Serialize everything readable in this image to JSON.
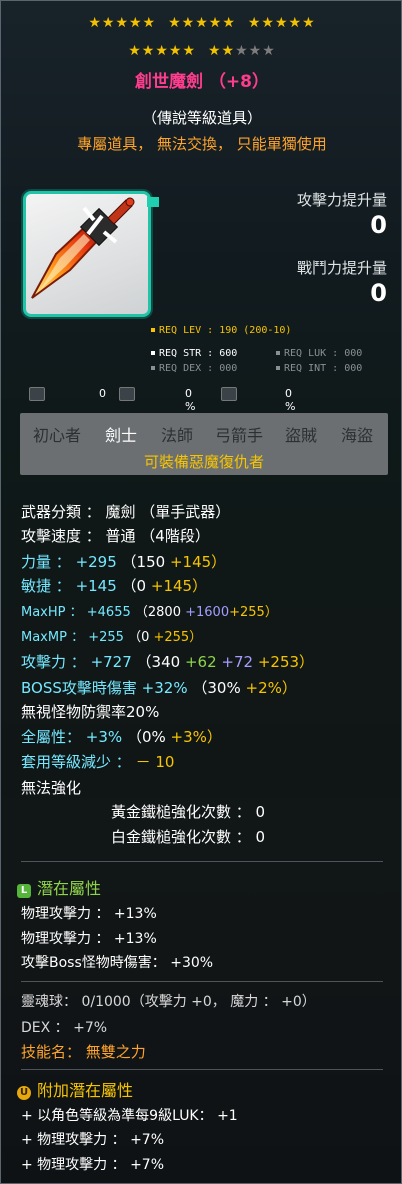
{
  "stars": {
    "row1": "★★★★★",
    "row2": "★★★★★",
    "row3": "★★★★★",
    "row4_on": "★★★★★",
    "row5_on": "★★",
    "row5_off": "★★★"
  },
  "item": {
    "name": "創世魔劍 （+8）",
    "grade": "（傳說等級道具）",
    "trade": "專屬道具， 無法交換， 只能單獨使用"
  },
  "compare": {
    "atk_label": "攻擊力提升量",
    "atk_val": "0",
    "power_label": "戰鬥力提升量",
    "power_val": "0"
  },
  "req": {
    "lev": "REQ LEV : 190 (200-10)",
    "str": "REQ STR : 600",
    "luk": "REQ LUK : 000",
    "dex": "REQ DEX : 000",
    "int": "REQ INT : 000"
  },
  "rowicons": {
    "a": "0",
    "b": "0 %",
    "c": "0 %"
  },
  "jobs": [
    "初心者",
    "劍士",
    "法師",
    "弓箭手",
    "盜賊",
    "海盜"
  ],
  "job_note": "可裝備惡魔復仇者",
  "stats": {
    "weapon_type": "武器分類 ： 魔劍 （單手武器）",
    "speed": "攻擊速度 ： 普通 （4階段）",
    "str_k": "力量 ：",
    "str_v": "+295",
    "str_a": "（150",
    "str_b": "+145）",
    "dex_k": "敏捷 ：",
    "dex_v": "+145",
    "dex_a": "（0",
    "dex_b": "+145）",
    "hp_k": "MaxHP ：",
    "hp_v": "+4655",
    "hp_a": "（2800",
    "hp_b": "+1600",
    "hp_c": "+255）",
    "mp_k": "MaxMP ：",
    "mp_v": "+255",
    "mp_a": "（0",
    "mp_b": "+255）",
    "atk_k": "攻擊力 ：",
    "atk_v": "+727",
    "atk_a": "（340",
    "atk_b": "+62",
    "atk_c": "+72",
    "atk_d": "+253）",
    "boss_k": "BOSS攻擊時傷害",
    "boss_v": "+32%",
    "boss_a": "（30%",
    "boss_b": "+2%）",
    "ignore": "無視怪物防禦率20%",
    "all_k": "全屬性：",
    "all_v": "+3%",
    "all_a": "（0%",
    "all_b": "+3%）",
    "lvred_k": "套用等級減少 ：",
    "lvred_v": "－ 10",
    "noenh": "無法強化",
    "gold": "黃金鐵槌強化次數 ： 0",
    "plat": "白金鐵槌強化次數 ： 0"
  },
  "potential": {
    "badge": "L",
    "title": "潛在屬性",
    "lines": [
      "物理攻擊力 ： +13%",
      "物理攻擊力 ： +13%",
      "攻擊Boss怪物時傷害： +30%"
    ]
  },
  "soul": {
    "line": "靈魂球： 0/1000（攻擊力 +0， 魔力 ： +0）",
    "dex": "DEX ： +7%",
    "skill": "技能名： 無雙之力"
  },
  "bonus": {
    "badge": "U",
    "title": "附加潛在屬性",
    "lines": [
      "+ 以角色等級為準每9級LUK： +1",
      "+ 物理攻擊力 ： +7%",
      "+ 物理攻擊力 ： +7%"
    ]
  },
  "colors": {
    "accent_yellow": "#f7c400",
    "title_pink": "#ff3d8e",
    "cyan": "#75e8ff",
    "orange": "#ffa42b",
    "purple": "#a59dff",
    "green": "#8ed44a",
    "teal_frame": "#21c4a8"
  }
}
